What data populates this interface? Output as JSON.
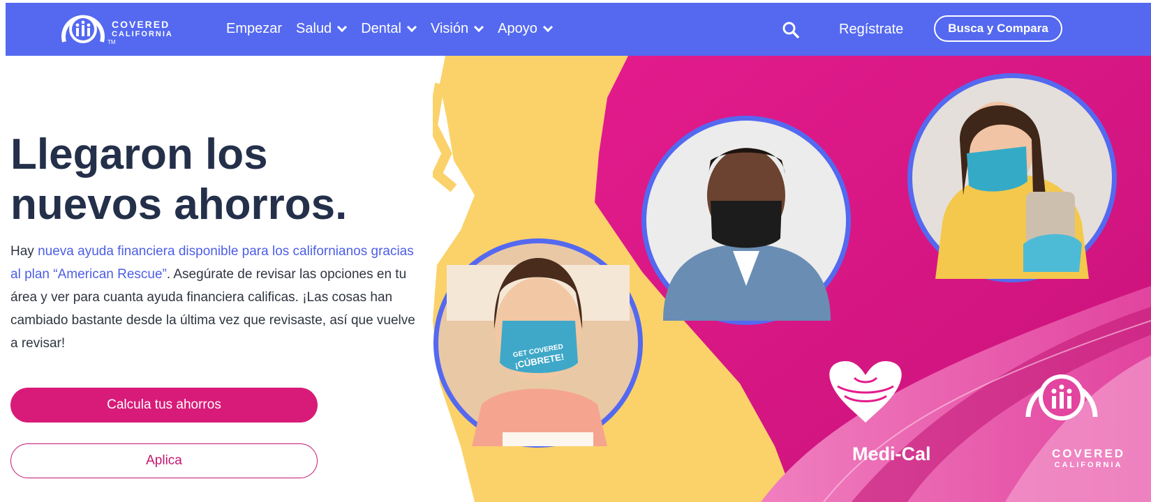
{
  "brand": {
    "logo_line1": "COVERED",
    "logo_line2": "CALIFORNIA",
    "logo_tm": "TM",
    "primary_color": "#5469f0",
    "accent_color": "#d81b78"
  },
  "nav": {
    "items": [
      {
        "label": "Empezar",
        "has_dropdown": false
      },
      {
        "label": "Salud",
        "has_dropdown": true
      },
      {
        "label": "Dental",
        "has_dropdown": true
      },
      {
        "label": "Visión",
        "has_dropdown": true
      },
      {
        "label": "Apoyo",
        "has_dropdown": true
      }
    ],
    "search_icon": "search-icon",
    "register_label": "Regístrate",
    "compare_label": "Busca y Compara"
  },
  "hero": {
    "headline": "Llegaron los nuevos ahorros.",
    "body_prefix": "Hay ",
    "body_link": "nueva ayuda financiera disponible para los californianos gracias al plan “American Rescue”",
    "body_suffix": ". Asegúrate de revisar las opciones en tu área y ver para cuanta ayuda financiera calificas.  ¡Las cosas han cambiado bastante desde la última vez que revisaste, así que vuelve a revisar!",
    "primary_button": "Calcula tus ahorros",
    "secondary_button": "Aplica"
  },
  "art": {
    "medi_cal_label": "Medi-Cal",
    "cc_line1": "COVERED",
    "cc_line2": "CALIFORNIA",
    "mask_text_girl_1": "GET COVERED",
    "mask_text_girl_2": "¡CÚBRETE!"
  }
}
